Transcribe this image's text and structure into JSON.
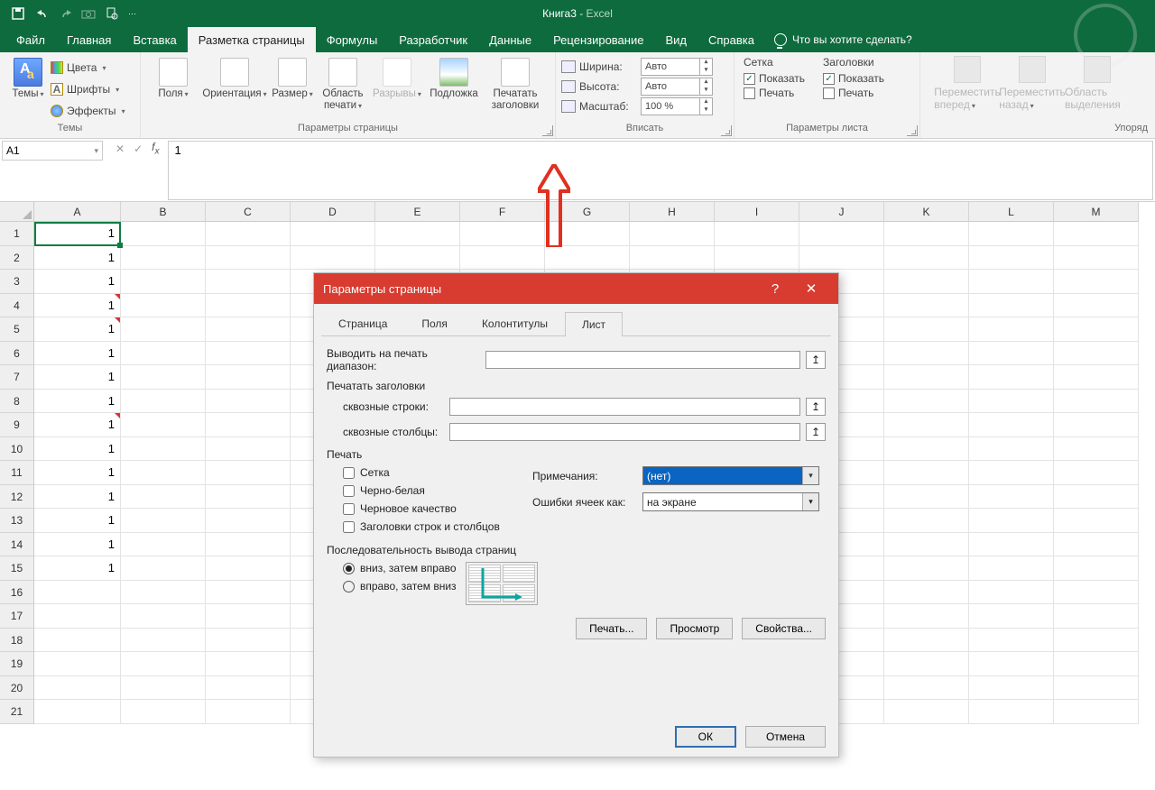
{
  "title": {
    "doc": "Книга3",
    "sep": " - ",
    "app": "Excel"
  },
  "tabs": {
    "file": "Файл",
    "home": "Главная",
    "insert": "Вставка",
    "pagelayout": "Разметка страницы",
    "formulas": "Формулы",
    "developer": "Разработчик",
    "data": "Данные",
    "review": "Рецензирование",
    "view": "Вид",
    "help": "Справка",
    "tellme": "Что вы хотите сделать?"
  },
  "ribbon": {
    "themes": {
      "label": "Темы",
      "themes_btn": "Темы",
      "colors": "Цвета",
      "fonts": "Шрифты",
      "effects": "Эффекты"
    },
    "pagesetup": {
      "label": "Параметры страницы",
      "margins": "Поля",
      "orientation": "Ориентация",
      "size": "Размер",
      "printarea": "Область печати",
      "breaks": "Разрывы",
      "background": "Подложка",
      "printtitles": "Печатать заголовки"
    },
    "fit": {
      "label": "Вписать",
      "width": "Ширина:",
      "height": "Высота:",
      "scale": "Масштаб:",
      "auto": "Авто",
      "scale_val": "100 %"
    },
    "sheetopts": {
      "label": "Параметры листа",
      "gridlines": "Сетка",
      "headings": "Заголовки",
      "show": "Показать",
      "print": "Печать"
    },
    "arrange": {
      "label": "Упоряд",
      "forward": "Переместить вперед",
      "backward": "Переместить назад",
      "selpane": "Область выделения"
    }
  },
  "formula_bar": {
    "namebox": "A1",
    "value": "1"
  },
  "grid": {
    "cols": [
      "A",
      "B",
      "C",
      "D",
      "E",
      "F",
      "G",
      "H",
      "I",
      "J",
      "K",
      "L",
      "M"
    ],
    "rows": [
      "1",
      "2",
      "3",
      "4",
      "5",
      "6",
      "7",
      "8",
      "9",
      "10",
      "11",
      "12",
      "13",
      "14",
      "15",
      "16",
      "17",
      "18",
      "19",
      "20",
      "21"
    ],
    "a_values": [
      "1",
      "1",
      "1",
      "1",
      "1",
      "1",
      "1",
      "1",
      "1",
      "1",
      "1",
      "1",
      "1",
      "1",
      "1",
      "",
      "",
      "",
      "",
      "",
      ""
    ],
    "marks": [
      3,
      4,
      8
    ]
  },
  "dialog": {
    "title": "Параметры страницы",
    "tabs": {
      "page": "Страница",
      "margins": "Поля",
      "hf": "Колонтитулы",
      "sheet": "Лист"
    },
    "print_range_lbl": "Выводить на печать диапазон:",
    "print_titles_grp": "Печатать заголовки",
    "rows_repeat": "сквозные строки:",
    "cols_repeat": "сквозные столбцы:",
    "print_grp": "Печать",
    "chk_grid": "Сетка",
    "chk_bw": "Черно-белая",
    "chk_draft": "Черновое качество",
    "chk_rowcol": "Заголовки строк и столбцов",
    "notes_lbl": "Примечания:",
    "notes_val": "(нет)",
    "errors_lbl": "Ошибки ячеек как:",
    "errors_val": "на экране",
    "order_grp": "Последовательность вывода страниц",
    "order_down": "вниз, затем вправо",
    "order_over": "вправо, затем вниз",
    "btn_print": "Печать...",
    "btn_preview": "Просмотр",
    "btn_options": "Свойства...",
    "btn_ok": "ОК",
    "btn_cancel": "Отмена"
  }
}
